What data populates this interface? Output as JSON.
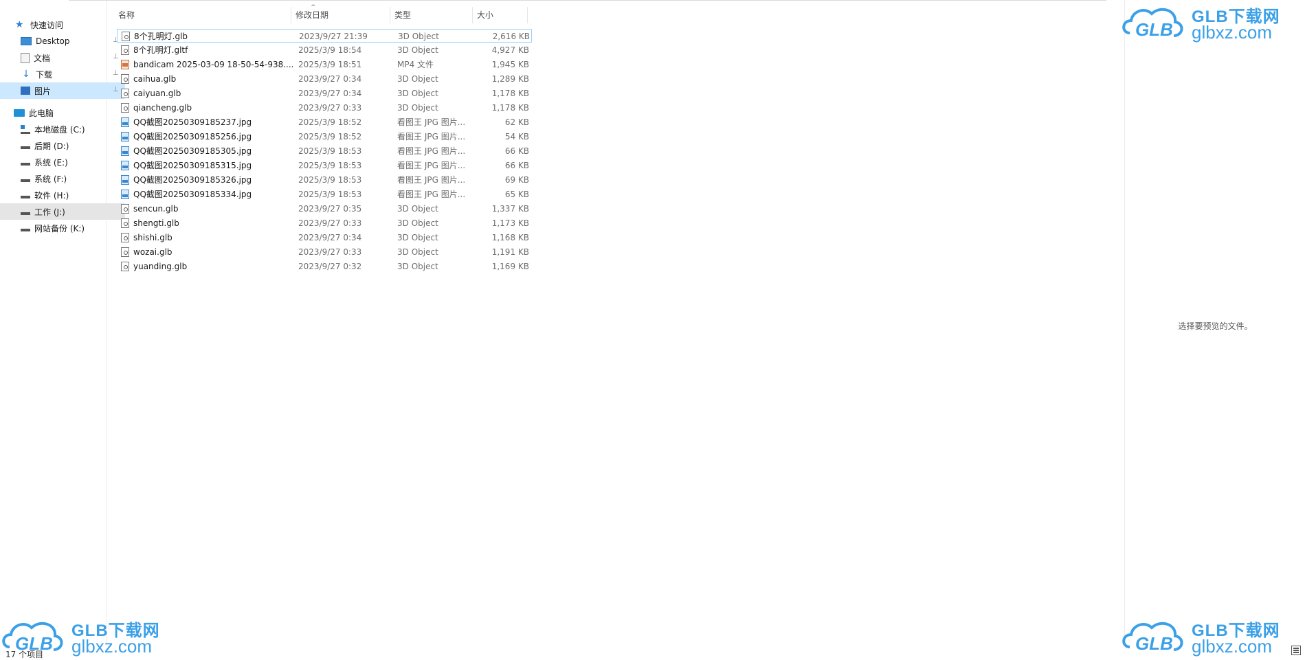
{
  "nav": {
    "items": [
      {
        "label": "快速访问",
        "icon": "star-icon"
      },
      {
        "label": "Desktop",
        "icon": "desktop-icon",
        "pinned": true
      },
      {
        "label": "文档",
        "icon": "document-icon",
        "pinned": true
      },
      {
        "label": "下载",
        "icon": "download-icon",
        "pinned": true
      },
      {
        "label": "图片",
        "icon": "picture-icon",
        "pinned": true
      },
      {
        "label": "此电脑",
        "icon": "computer-icon"
      },
      {
        "label": "本地磁盘 (C:)",
        "icon": "system-drive-icon"
      },
      {
        "label": "后期 (D:)",
        "icon": "drive-icon"
      },
      {
        "label": "系统 (E:)",
        "icon": "drive-icon"
      },
      {
        "label": "系统 (F:)",
        "icon": "drive-icon"
      },
      {
        "label": "软件 (H:)",
        "icon": "drive-icon"
      },
      {
        "label": "工作 (J:)",
        "icon": "drive-icon"
      },
      {
        "label": "网站备份 (K:)",
        "icon": "drive-icon"
      }
    ],
    "pin_glyph": "📌"
  },
  "columns": {
    "name": "名称",
    "date": "修改日期",
    "type": "类型",
    "size": "大小",
    "sort_indicator": "^"
  },
  "files": [
    {
      "name": "8个孔明灯.glb",
      "date": "2023/9/27 21:39",
      "type": "3D Object",
      "size": "2,616 KB",
      "kind": "obj"
    },
    {
      "name": "8个孔明灯.gltf",
      "date": "2025/3/9 18:54",
      "type": "3D Object",
      "size": "4,927 KB",
      "kind": "obj"
    },
    {
      "name": "bandicam 2025-03-09 18-50-54-938....",
      "date": "2025/3/9 18:51",
      "type": "MP4 文件",
      "size": "1,945 KB",
      "kind": "mp4"
    },
    {
      "name": "caihua.glb",
      "date": "2023/9/27 0:34",
      "type": "3D Object",
      "size": "1,289 KB",
      "kind": "obj"
    },
    {
      "name": "caiyuan.glb",
      "date": "2023/9/27 0:34",
      "type": "3D Object",
      "size": "1,178 KB",
      "kind": "obj"
    },
    {
      "name": "qiancheng.glb",
      "date": "2023/9/27 0:33",
      "type": "3D Object",
      "size": "1,178 KB",
      "kind": "obj"
    },
    {
      "name": "QQ截图20250309185237.jpg",
      "date": "2025/3/9 18:52",
      "type": "看图王 JPG 图片...",
      "size": "62 KB",
      "kind": "jpg"
    },
    {
      "name": "QQ截图20250309185256.jpg",
      "date": "2025/3/9 18:52",
      "type": "看图王 JPG 图片...",
      "size": "54 KB",
      "kind": "jpg"
    },
    {
      "name": "QQ截图20250309185305.jpg",
      "date": "2025/3/9 18:53",
      "type": "看图王 JPG 图片...",
      "size": "66 KB",
      "kind": "jpg"
    },
    {
      "name": "QQ截图20250309185315.jpg",
      "date": "2025/3/9 18:53",
      "type": "看图王 JPG 图片...",
      "size": "66 KB",
      "kind": "jpg"
    },
    {
      "name": "QQ截图20250309185326.jpg",
      "date": "2025/3/9 18:53",
      "type": "看图王 JPG 图片...",
      "size": "69 KB",
      "kind": "jpg"
    },
    {
      "name": "QQ截图20250309185334.jpg",
      "date": "2025/3/9 18:53",
      "type": "看图王 JPG 图片...",
      "size": "65 KB",
      "kind": "jpg"
    },
    {
      "name": "sencun.glb",
      "date": "2023/9/27 0:35",
      "type": "3D Object",
      "size": "1,337 KB",
      "kind": "obj"
    },
    {
      "name": "shengti.glb",
      "date": "2023/9/27 0:33",
      "type": "3D Object",
      "size": "1,173 KB",
      "kind": "obj"
    },
    {
      "name": "shishi.glb",
      "date": "2023/9/27 0:34",
      "type": "3D Object",
      "size": "1,168 KB",
      "kind": "obj"
    },
    {
      "name": "wozai.glb",
      "date": "2023/9/27 0:33",
      "type": "3D Object",
      "size": "1,191 KB",
      "kind": "obj"
    },
    {
      "name": "yuanding.glb",
      "date": "2023/9/27 0:32",
      "type": "3D Object",
      "size": "1,169 KB",
      "kind": "obj"
    }
  ],
  "preview": {
    "message": "选择要预览的文件。"
  },
  "status": {
    "item_count": "17 个项目"
  },
  "watermark": {
    "brand": "GLB下载网",
    "domain": "glbxz.com",
    "logo_text": "GLB",
    "color": "#3aa0e8"
  },
  "colors": {
    "selection": "#cce8ff",
    "row_selected_border": "#99d1ff",
    "accent": "#2f7fd1"
  }
}
